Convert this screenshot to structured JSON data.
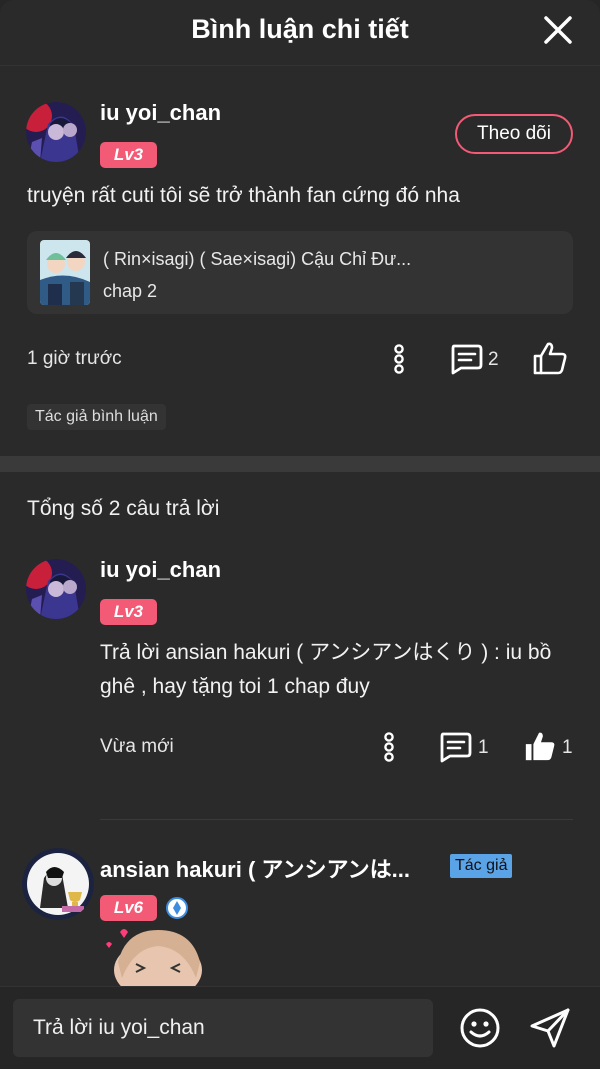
{
  "header": {
    "title": "Bình luận chi tiết"
  },
  "main_comment": {
    "username": "iu yoi_chan",
    "level": "Lv3",
    "follow_label": "Theo dõi",
    "text": "truyện rất cuti tôi sẽ trở thành fan cứng đó nha",
    "story": {
      "title": "( Rin×isagi) ( Sae×isagi) Cậu Chỉ Đư...",
      "chapter": "chap 2"
    },
    "time": "1 giờ trước",
    "reply_count": "2",
    "author_tag": "Tác giả bình luận"
  },
  "replies_header": "Tổng số 2 câu trả lời",
  "replies": [
    {
      "username": "iu yoi_chan",
      "level": "Lv3",
      "text": "Trả lời ansian hakuri ( アンシアンはくり ) : iu bồ ghê , hay tặng toi 1 chap đuy",
      "time": "Vừa mới",
      "reply_count": "1",
      "like_count": "1"
    },
    {
      "username": "ansian hakuri ( アンシアンは...",
      "level": "Lv6",
      "badge": "Tác giả"
    }
  ],
  "composer": {
    "placeholder": "Trả lời iu yoi_chan"
  },
  "colors": {
    "accent": "#f25a76",
    "author_badge": "#5aa3e6",
    "background": "#2a2a2a"
  },
  "icons": [
    "close-icon",
    "more-vert-icon",
    "comment-icon",
    "thumbs-up-icon",
    "emoji-icon",
    "send-icon",
    "verified-icon"
  ]
}
